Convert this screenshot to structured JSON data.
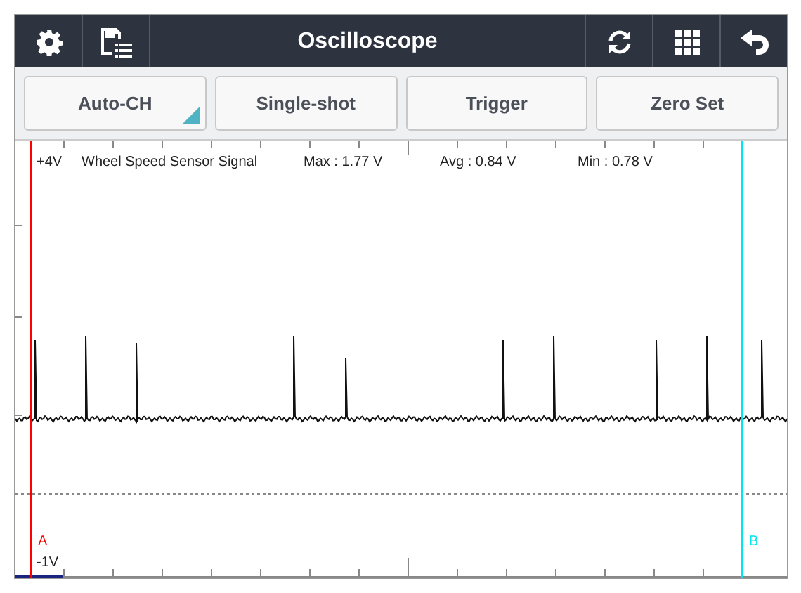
{
  "header": {
    "title": "Oscilloscope"
  },
  "buttons": [
    {
      "label": "Auto-CH",
      "kind": "dropdown"
    },
    {
      "label": "Single-shot",
      "kind": "plain"
    },
    {
      "label": "Trigger",
      "kind": "plain"
    },
    {
      "label": "Zero Set",
      "kind": "plain"
    }
  ],
  "scope": {
    "top_label": "+4V",
    "bottom_label": "-1V",
    "signal_name": "Wheel Speed Sensor Signal",
    "max": "Max : 1.77 V",
    "avg": "Avg : 0.84 V",
    "min": "Min : 0.78 V",
    "cursors": [
      {
        "label": "A",
        "color": "#ff0000"
      },
      {
        "label": "B",
        "color": "#00e5ee"
      }
    ]
  }
}
